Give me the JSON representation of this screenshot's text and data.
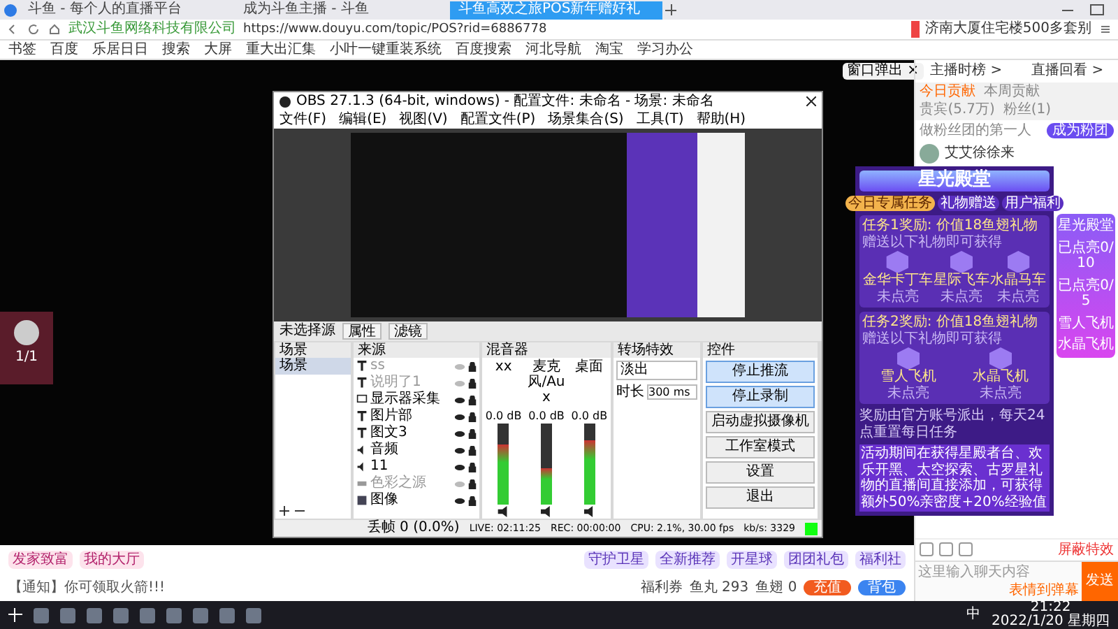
{
  "browser": {
    "tabs": [
      {
        "label": "斗鱼 - 每个人的直播平台",
        "selected": false
      },
      {
        "label": "成为斗鱼主播 - 斗鱼",
        "selected": false
      },
      {
        "label": "斗鱼高效之旅POS新年赠好礼",
        "selected": true
      }
    ],
    "site_owner": "武汉斗鱼网络科技有限公司",
    "url": "https://www.douyu.com/topic/POS?rid=6886778",
    "search_value": "济南大厦住宅楼500多套别",
    "bookmarks": [
      "书签",
      "百度",
      "乐居日日",
      "搜索",
      "大屏",
      "重大出汇集",
      "小叶一键重装系统",
      "百度搜索",
      "河北导航",
      "淘宝",
      "学习办公"
    ]
  },
  "obs": {
    "title": "OBS 27.1.3 (64-bit, windows) - 配置文件: 未命名 - 场景: 未命名",
    "menu": [
      "文件(F)",
      "编辑(E)",
      "视图(V)",
      "配置文件(P)",
      "场景集合(S)",
      "工具(T)",
      "帮助(H)"
    ],
    "no_source": "未选择源",
    "props_buttons": [
      "属性",
      "滤镜"
    ],
    "scenes": {
      "title": "场景",
      "items": [
        {
          "label": "场景",
          "selected": true
        }
      ]
    },
    "sources": {
      "title": "来源",
      "items": [
        {
          "kind": "text",
          "label": "ss",
          "visible": false
        },
        {
          "kind": "text",
          "label": "说明了1",
          "visible": false
        },
        {
          "kind": "display",
          "label": "显示器采集",
          "visible": true
        },
        {
          "kind": "text",
          "label": "图片部",
          "visible": true
        },
        {
          "kind": "text",
          "label": "图文3",
          "visible": true
        },
        {
          "kind": "audio",
          "label": "音频",
          "visible": true
        },
        {
          "kind": "audio",
          "label": "11",
          "visible": true
        },
        {
          "kind": "color",
          "label": "色彩之源",
          "visible": false
        },
        {
          "kind": "image",
          "label": "图像",
          "visible": true
        }
      ]
    },
    "mixer": {
      "title": "混音器",
      "channels": [
        {
          "name": "xx",
          "reading": "0.0 dB",
          "level": 0.75
        },
        {
          "name": "麦克风/Aux",
          "reading": "0.0 dB",
          "level": 0.45
        },
        {
          "name": "桌面",
          "reading": "0.0 dB",
          "level": 0.8
        }
      ]
    },
    "transitions": {
      "title": "转场特效",
      "type": "淡出",
      "duration_label": "时长",
      "duration": "300 ms"
    },
    "controls": {
      "title": "控件",
      "buttons": [
        {
          "label": "停止推流",
          "active": true
        },
        {
          "label": "停止录制",
          "active": true
        },
        {
          "label": "启动虚拟摄像机",
          "active": false
        },
        {
          "label": "工作室模式",
          "active": false
        },
        {
          "label": "设置",
          "active": false
        },
        {
          "label": "退出",
          "active": false
        }
      ]
    },
    "status": [
      "丢帧 0 (0.0%)",
      "LIVE: 02:11:25",
      "REC: 00:00:00",
      "CPU: 2.1%, 30.00 fps",
      "kb/s: 3329"
    ]
  },
  "stage": {
    "popout_button": "窗口弹出",
    "popout_close": "×",
    "avatar_count": "1/1"
  },
  "promo": {
    "title": "星光殿堂",
    "tabs": [
      {
        "label": "今日专属任务",
        "selected": true
      },
      {
        "label": "礼物赠送",
        "selected": false
      },
      {
        "label": "用户福利",
        "selected": false
      }
    ],
    "tasks": [
      {
        "title": "任务1奖励: 价值18鱼翅礼物",
        "hint": "赠送以下礼物即可获得",
        "gifts": [
          {
            "name": "金华卡丁车",
            "status": "未点亮"
          },
          {
            "name": "星际飞车",
            "status": "未点亮"
          },
          {
            "name": "水晶马车",
            "status": "未点亮"
          }
        ]
      },
      {
        "title": "任务2奖励: 价值18鱼翅礼物",
        "hint": "赠送以下礼物即可获得",
        "gifts": [
          {
            "name": "雪人飞机",
            "status": "未点亮"
          },
          {
            "name": "水晶飞机",
            "status": "未点亮"
          }
        ]
      }
    ],
    "note": "奖励由官方账号派出，每天24点重置每日任务",
    "footer": "活动期间在获得星殿者台、欢乐开黑、太空探索、古罗星礼物的直播间直接添加，可获得额外50%亲密度+20%经验值"
  },
  "side_widget": {
    "title": "星光殿堂",
    "progress_1": "已点亮0/10",
    "progress_2": "已点亮0/5",
    "gifts": [
      "雪人飞机",
      "水晶飞机"
    ]
  },
  "right_panel": {
    "links": [
      "主播时榜 >",
      "直播回看 >"
    ],
    "tabs": [
      {
        "label": "今日贡献",
        "selected": true
      },
      {
        "label": "本周贡献",
        "selected": false
      },
      {
        "label": "贵宾(5.7万)",
        "selected": false
      },
      {
        "label": "粉丝(1)",
        "selected": false
      }
    ],
    "fan_hint": "做粉丝团的第一人",
    "fan_button": "成为粉团",
    "user": "艾艾徐徐来",
    "block_effects": "屏蔽特效",
    "chat_placeholder": "这里输入聊天内容",
    "emote_hint": "表情到弹幕",
    "send": "发送"
  },
  "bottom_bar": {
    "left_gifts": [
      "发家致富",
      "我的大厅"
    ],
    "right_gifts": [
      "守护卫星",
      "全新推荐",
      "开星球",
      "团团礼包",
      "福利社"
    ],
    "notice": "【通知】你可领取火箭!!!",
    "coupons": "福利券",
    "fish_balls": "鱼丸 293",
    "fins": "鱼翅 0",
    "recharge": "充值",
    "backpack": "背包"
  },
  "taskbar": {
    "ime": "中",
    "time": "21:22",
    "date": "2022/1/20 星期四"
  }
}
